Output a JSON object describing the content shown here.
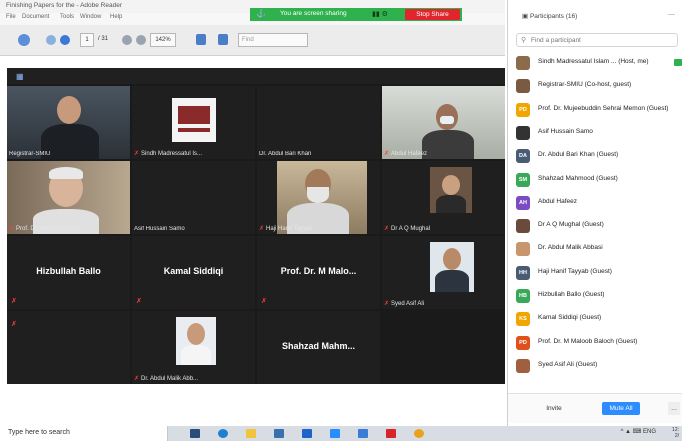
{
  "acrobat": {
    "title": "Finishing Papers for the - Adobe Reader",
    "menu": [
      "File",
      "Document",
      "Tools",
      "Window",
      "Help"
    ],
    "page_current": "1",
    "page_total": "/ 31",
    "zoom": "142%",
    "find_placeholder": "Find"
  },
  "share_bar": {
    "pin_icon": "pin-icon",
    "status_text": "You are screen sharing",
    "stop_label": "Stop Share"
  },
  "gallery": {
    "tiles": [
      {
        "label": "Registrar-SMIU",
        "muted": false
      },
      {
        "label": "Sindh Madressatul Is...",
        "muted": true
      },
      {
        "label": "Dr. Abdul Bari Khan",
        "muted": false
      },
      {
        "label": "Abdul Hafeez",
        "muted": true
      },
      {
        "label": "Prof. Dr. Mujeebuddin S...",
        "muted": true
      },
      {
        "label": "Asif Hussain Samo",
        "muted": false
      },
      {
        "label": "Haji Hanif Tayyab",
        "muted": true
      },
      {
        "label": "Dr A Q Mughal",
        "muted": true
      },
      {
        "label": "Hizbullah Ballo",
        "muted": true,
        "name_only": true
      },
      {
        "label": "Kamal Siddiqi",
        "muted": true,
        "name_only": true
      },
      {
        "label": "Prof. Dr. M Malo...",
        "muted": true,
        "name_only": true
      },
      {
        "label": "Syed Asif Ali",
        "muted": true
      },
      {
        "label": "",
        "muted": true
      },
      {
        "label": "Dr. Abdul Malik Abb...",
        "muted": true
      },
      {
        "label": "Shahzad Mahm...",
        "muted": false,
        "name_only": true
      }
    ]
  },
  "participants": {
    "title": "Participants (16)",
    "search_placeholder": "Find a participant",
    "list": [
      {
        "name": "Sindh Madressatul Islam ... (Host, me)",
        "initials": "",
        "color": "#8b6b4a"
      },
      {
        "name": "Registrar-SMIU (Co-host, guest)",
        "initials": "",
        "color": "#7a5a40"
      },
      {
        "name": "Prof. Dr. Mujeebuddin Sehrai Memon (Guest)",
        "initials": "PD",
        "color": "#f0a500"
      },
      {
        "name": "Asif Hussain Samo",
        "initials": "",
        "color": "#333333"
      },
      {
        "name": "Dr. Abdul Bari Khan (Guest)",
        "initials": "DA",
        "color": "#4a5c73"
      },
      {
        "name": "Shahzad Mahmood (Guest)",
        "initials": "SM",
        "color": "#39a857"
      },
      {
        "name": "Abdul Hafeez",
        "initials": "AH",
        "color": "#7a4bc2"
      },
      {
        "name": "Dr A Q Mughal (Guest)",
        "initials": "",
        "color": "#6a4a3a"
      },
      {
        "name": "Dr. Abdul Malik Abbasi",
        "initials": "",
        "color": "#c9956c"
      },
      {
        "name": "Haji Hanif Tayyab (Guest)",
        "initials": "HH",
        "color": "#4a5c73"
      },
      {
        "name": "Hizbullah Ballo (Guest)",
        "initials": "HB",
        "color": "#39a857"
      },
      {
        "name": "Kamal Siddiqi (Guest)",
        "initials": "KS",
        "color": "#f0a500"
      },
      {
        "name": "Prof. Dr. M Maloob Baloch (Guest)",
        "initials": "PD",
        "color": "#e0501a"
      },
      {
        "name": "Syed Asif Ali (Guest)",
        "initials": "",
        "color": "#a06040"
      }
    ],
    "invite_label": "Invite",
    "mute_all_label": "Mute All",
    "more_label": "..."
  },
  "taskbar": {
    "search_text": "Type here to search",
    "tray_text": "^ ▲ ⌨ ENG",
    "time": "12:",
    "date": "2/"
  },
  "colors": {
    "share_green": "#2fb24e",
    "stop_red": "#e0262c",
    "zoom_blue": "#2d8cff",
    "gallery_bg": "#1a1a1a"
  }
}
